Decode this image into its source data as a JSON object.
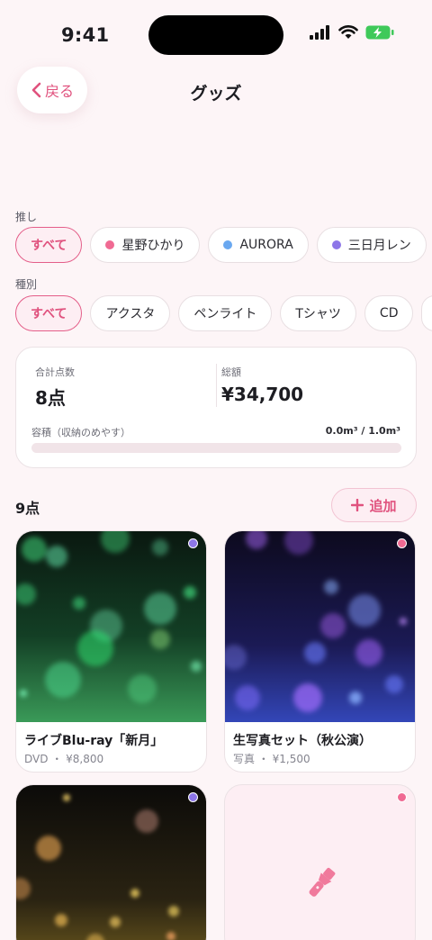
{
  "status": {
    "time": "9:41"
  },
  "nav": {
    "back_label": "戻る",
    "title": "グッズ"
  },
  "filters": {
    "oshi": {
      "label": "推し",
      "chips": [
        {
          "label": "すべて",
          "active": true
        },
        {
          "label": "星野ひかり",
          "color": "#f06a93"
        },
        {
          "label": "AURORA",
          "color": "#6aa8f0"
        },
        {
          "label": "三日月レン",
          "color": "#8d76e8"
        }
      ]
    },
    "kind": {
      "label": "種別",
      "chips": [
        {
          "label": "すべて",
          "active": true
        },
        {
          "label": "アクスタ"
        },
        {
          "label": "ペンライト"
        },
        {
          "label": "Tシャツ"
        },
        {
          "label": "CD"
        }
      ]
    }
  },
  "summary": {
    "count_label": "合計点数",
    "count_value": "8点",
    "total_label": "総額",
    "total_value": "¥34,700",
    "volume_label": "容積（収納のめやす）",
    "volume_value": "0.0m³ / 1.0m³",
    "volume_fraction": 0.0
  },
  "items_header": {
    "count": "9点",
    "add_label": "追加"
  },
  "items": [
    {
      "name": "ライブBlu-ray「新月」",
      "meta": "DVD ・ ¥8,800",
      "oshi_color": "#8d76e8",
      "image": "green-bokeh"
    },
    {
      "name": "生写真セット（秋公演）",
      "meta": "写真 ・ ¥1,500",
      "oshi_color": "#f06a93",
      "image": "purple-bokeh"
    },
    {
      "name": "",
      "meta": "",
      "oshi_color": "#8d76e8",
      "image": "gold-bokeh"
    },
    {
      "name": "",
      "meta": "",
      "oshi_color": "#f06a93",
      "image": "penlight-icon"
    }
  ]
}
